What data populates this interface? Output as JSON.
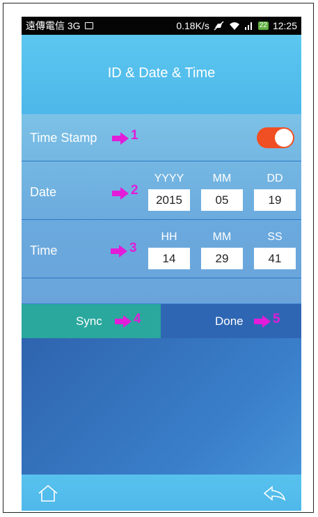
{
  "statusbar": {
    "carrier": "遠傳電信 3G",
    "speed": "0.18K/s",
    "battery": "22",
    "time": "12:25",
    "icons": [
      "image-icon",
      "mute-icon",
      "wifi-icon",
      "signal-icon",
      "battery-icon"
    ]
  },
  "header": {
    "title": "ID & Date & Time"
  },
  "rows": {
    "timestamp": {
      "label": "Time Stamp",
      "marker": "1",
      "toggle_on": true
    },
    "date": {
      "label": "Date",
      "marker": "2",
      "fields": [
        {
          "caption": "YYYY",
          "value": "2015"
        },
        {
          "caption": "MM",
          "value": "05"
        },
        {
          "caption": "DD",
          "value": "19"
        }
      ]
    },
    "time": {
      "label": "Time",
      "marker": "3",
      "fields": [
        {
          "caption": "HH",
          "value": "14"
        },
        {
          "caption": "MM",
          "value": "29"
        },
        {
          "caption": "SS",
          "value": "41"
        }
      ]
    }
  },
  "buttons": {
    "sync": {
      "label": "Sync",
      "marker": "4"
    },
    "done": {
      "label": "Done",
      "marker": "5"
    }
  },
  "nav": {
    "icons": [
      "home-icon",
      "back-icon"
    ]
  },
  "colors": {
    "marker": "#e21cd9",
    "toggle": "#f04e23",
    "sync": "#2aa89e",
    "done": "#2f66b3"
  }
}
